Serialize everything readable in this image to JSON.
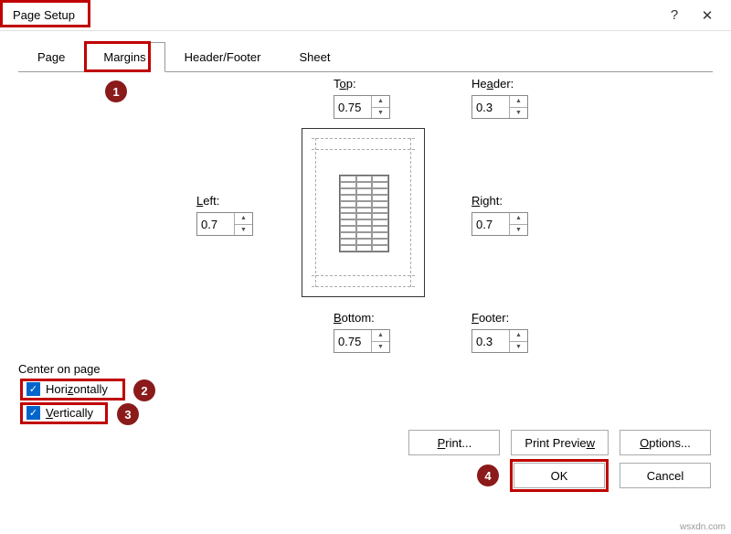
{
  "window": {
    "title": "Page Setup",
    "help": "?",
    "close": "✕"
  },
  "tabs": {
    "page": "Page",
    "margins": "Margins",
    "headerfooter": "Header/Footer",
    "sheet": "Sheet"
  },
  "labels": {
    "top_pre": "T",
    "top_u": "o",
    "top_post": "p:",
    "header_pre": "He",
    "header_u": "a",
    "header_post": "der:",
    "left_pre": "",
    "left_u": "L",
    "left_post": "eft:",
    "right_pre": "",
    "right_u": "R",
    "right_post": "ight:",
    "bottom_pre": "",
    "bottom_u": "B",
    "bottom_post": "ottom:",
    "footer_pre": "",
    "footer_u": "F",
    "footer_post": "ooter:"
  },
  "values": {
    "top": "0.75",
    "header": "0.3",
    "left": "0.7",
    "right": "0.7",
    "bottom": "0.75",
    "footer": "0.3"
  },
  "center": {
    "label": "Center on page",
    "horiz_pre": "Hori",
    "horiz_u": "z",
    "horiz_post": "ontally",
    "vert_pre": "",
    "vert_u": "V",
    "vert_post": "ertically"
  },
  "buttons": {
    "print_pre": "",
    "print_u": "P",
    "print_post": "rint...",
    "preview_pre": "Print Previe",
    "preview_u": "w",
    "preview_post": "",
    "options_pre": "",
    "options_u": "O",
    "options_post": "ptions...",
    "ok": "OK",
    "cancel": "Cancel"
  },
  "badges": {
    "b1": "1",
    "b2": "2",
    "b3": "3",
    "b4": "4"
  },
  "watermark": "wsxdn.com"
}
